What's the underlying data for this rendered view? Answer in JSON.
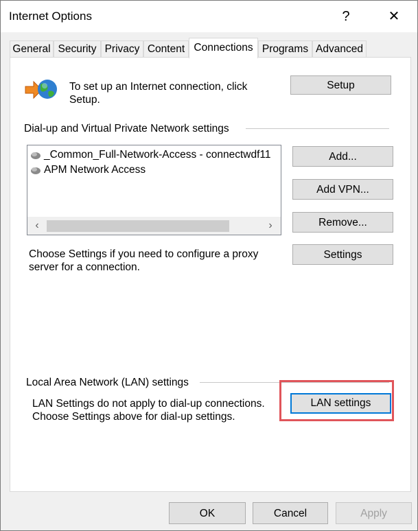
{
  "window": {
    "title": "Internet Options",
    "help_glyph": "?",
    "close_glyph": "✕"
  },
  "tabs": [
    {
      "label": "General"
    },
    {
      "label": "Security"
    },
    {
      "label": "Privacy"
    },
    {
      "label": "Content"
    },
    {
      "label": "Connections",
      "active": true
    },
    {
      "label": "Programs"
    },
    {
      "label": "Advanced"
    }
  ],
  "setup": {
    "text": "To set up an Internet connection, click Setup.",
    "button": "Setup"
  },
  "dialup": {
    "heading": "Dial-up and Virtual Private Network settings",
    "items": [
      {
        "label": "_Common_Full-Network-Access - connectwdf11"
      },
      {
        "label": "APM Network Access"
      }
    ],
    "scroll_left": "‹",
    "scroll_right": "›",
    "add_button": "Add...",
    "add_vpn_button": "Add VPN...",
    "remove_button": "Remove...",
    "settings_button": "Settings",
    "settings_text": "Choose Settings if you need to configure a proxy server for a connection."
  },
  "lan": {
    "heading": "Local Area Network (LAN) settings",
    "text_line1": "LAN Settings do not apply to dial-up connections.",
    "text_line2": "Choose Settings above for dial-up settings.",
    "button": "LAN settings"
  },
  "footer": {
    "ok": "OK",
    "cancel": "Cancel",
    "apply": "Apply"
  },
  "colors": {
    "highlight": "#e0555a",
    "focus_border": "#0078d7"
  }
}
